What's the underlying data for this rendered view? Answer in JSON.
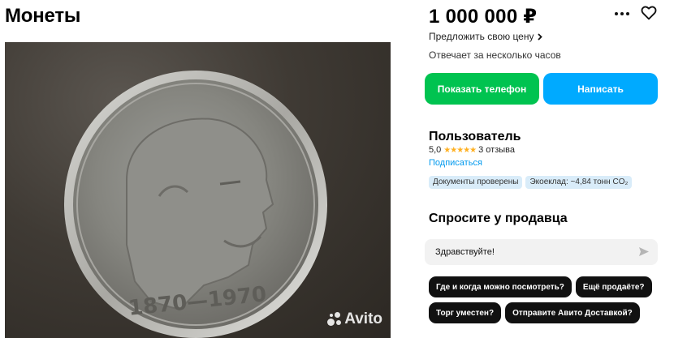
{
  "listing": {
    "title": "Монеты",
    "price": "1 000 000 ₽",
    "offer_price_label": "Предложить свою цену",
    "response_time": "Отвечает за несколько часов"
  },
  "photo": {
    "coin_inscription": "1870—1970",
    "watermark": "Avito"
  },
  "actions": {
    "show_phone": "Показать телефон",
    "write": "Написать",
    "more_icon": "more-dots-icon",
    "favorite_icon": "heart-icon"
  },
  "seller": {
    "name": "Пользователь",
    "rating": "5,0",
    "stars": "★★★★★",
    "reviews": "3 отзыва",
    "subscribe": "Подписаться",
    "badges": [
      "Документы проверены",
      "Экоеклад: ~4,84 тонн CO₂"
    ]
  },
  "ask": {
    "title": "Спросите у продавца",
    "input_value": "Здравствуйте!",
    "quick_questions": [
      "Где и когда можно посмотреть?",
      "Ещё продаёте?",
      "Торг уместен?",
      "Отправите Авито Доставкой?"
    ]
  },
  "colors": {
    "green": "#00c350",
    "blue": "#00aaff",
    "star": "#ffb021",
    "link": "#0099ee",
    "badge_bg": "#d9ecf9"
  }
}
